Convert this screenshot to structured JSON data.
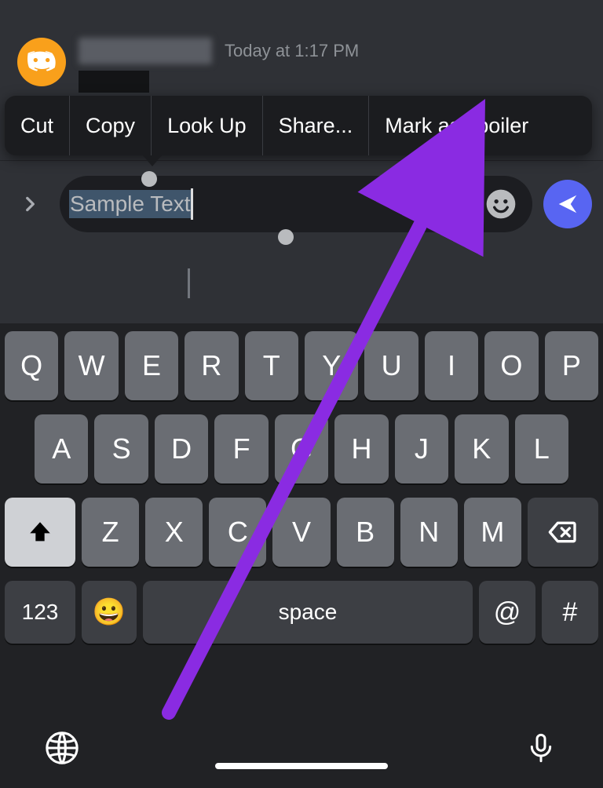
{
  "message": {
    "timestamp": "Today at 1:17 PM"
  },
  "context_menu": {
    "items": [
      "Cut",
      "Copy",
      "Look Up",
      "Share...",
      "Mark as spoiler"
    ]
  },
  "input": {
    "text": "Sample Text"
  },
  "keyboard": {
    "row1": [
      "Q",
      "W",
      "E",
      "R",
      "T",
      "Y",
      "U",
      "I",
      "O",
      "P"
    ],
    "row2": [
      "A",
      "S",
      "D",
      "F",
      "G",
      "H",
      "J",
      "K",
      "L"
    ],
    "row3": [
      "Z",
      "X",
      "C",
      "V",
      "B",
      "N",
      "M"
    ],
    "numeric_label": "123",
    "space_label": "space",
    "at_label": "@",
    "hash_label": "#",
    "emoji_glyph": "😀"
  }
}
